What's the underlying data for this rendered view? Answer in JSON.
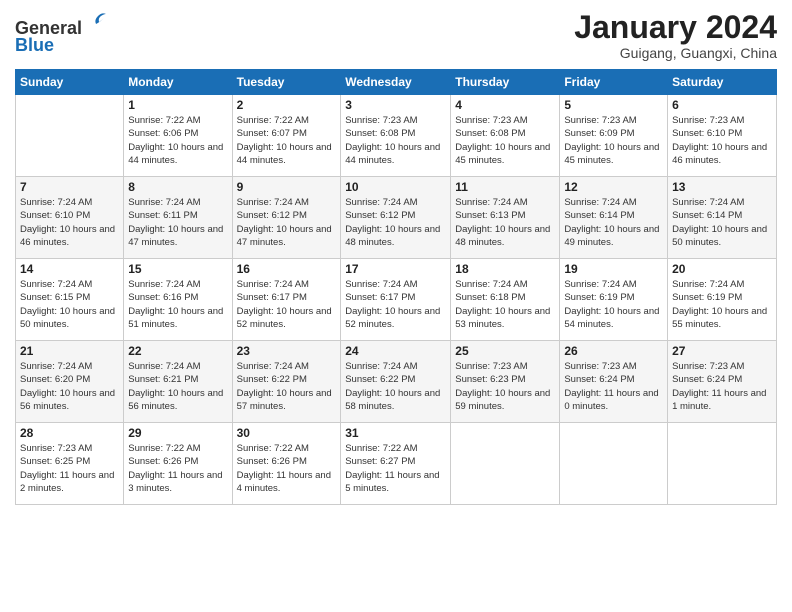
{
  "header": {
    "logo_line1": "General",
    "logo_line2": "Blue",
    "month_title": "January 2024",
    "location": "Guigang, Guangxi, China"
  },
  "days_of_week": [
    "Sunday",
    "Monday",
    "Tuesday",
    "Wednesday",
    "Thursday",
    "Friday",
    "Saturday"
  ],
  "weeks": [
    [
      {
        "day": "",
        "info": ""
      },
      {
        "day": "1",
        "info": "Sunrise: 7:22 AM\nSunset: 6:06 PM\nDaylight: 10 hours\nand 44 minutes."
      },
      {
        "day": "2",
        "info": "Sunrise: 7:22 AM\nSunset: 6:07 PM\nDaylight: 10 hours\nand 44 minutes."
      },
      {
        "day": "3",
        "info": "Sunrise: 7:23 AM\nSunset: 6:08 PM\nDaylight: 10 hours\nand 44 minutes."
      },
      {
        "day": "4",
        "info": "Sunrise: 7:23 AM\nSunset: 6:08 PM\nDaylight: 10 hours\nand 45 minutes."
      },
      {
        "day": "5",
        "info": "Sunrise: 7:23 AM\nSunset: 6:09 PM\nDaylight: 10 hours\nand 45 minutes."
      },
      {
        "day": "6",
        "info": "Sunrise: 7:23 AM\nSunset: 6:10 PM\nDaylight: 10 hours\nand 46 minutes."
      }
    ],
    [
      {
        "day": "7",
        "info": "Sunrise: 7:24 AM\nSunset: 6:10 PM\nDaylight: 10 hours\nand 46 minutes."
      },
      {
        "day": "8",
        "info": "Sunrise: 7:24 AM\nSunset: 6:11 PM\nDaylight: 10 hours\nand 47 minutes."
      },
      {
        "day": "9",
        "info": "Sunrise: 7:24 AM\nSunset: 6:12 PM\nDaylight: 10 hours\nand 47 minutes."
      },
      {
        "day": "10",
        "info": "Sunrise: 7:24 AM\nSunset: 6:12 PM\nDaylight: 10 hours\nand 48 minutes."
      },
      {
        "day": "11",
        "info": "Sunrise: 7:24 AM\nSunset: 6:13 PM\nDaylight: 10 hours\nand 48 minutes."
      },
      {
        "day": "12",
        "info": "Sunrise: 7:24 AM\nSunset: 6:14 PM\nDaylight: 10 hours\nand 49 minutes."
      },
      {
        "day": "13",
        "info": "Sunrise: 7:24 AM\nSunset: 6:14 PM\nDaylight: 10 hours\nand 50 minutes."
      }
    ],
    [
      {
        "day": "14",
        "info": "Sunrise: 7:24 AM\nSunset: 6:15 PM\nDaylight: 10 hours\nand 50 minutes."
      },
      {
        "day": "15",
        "info": "Sunrise: 7:24 AM\nSunset: 6:16 PM\nDaylight: 10 hours\nand 51 minutes."
      },
      {
        "day": "16",
        "info": "Sunrise: 7:24 AM\nSunset: 6:17 PM\nDaylight: 10 hours\nand 52 minutes."
      },
      {
        "day": "17",
        "info": "Sunrise: 7:24 AM\nSunset: 6:17 PM\nDaylight: 10 hours\nand 52 minutes."
      },
      {
        "day": "18",
        "info": "Sunrise: 7:24 AM\nSunset: 6:18 PM\nDaylight: 10 hours\nand 53 minutes."
      },
      {
        "day": "19",
        "info": "Sunrise: 7:24 AM\nSunset: 6:19 PM\nDaylight: 10 hours\nand 54 minutes."
      },
      {
        "day": "20",
        "info": "Sunrise: 7:24 AM\nSunset: 6:19 PM\nDaylight: 10 hours\nand 55 minutes."
      }
    ],
    [
      {
        "day": "21",
        "info": "Sunrise: 7:24 AM\nSunset: 6:20 PM\nDaylight: 10 hours\nand 56 minutes."
      },
      {
        "day": "22",
        "info": "Sunrise: 7:24 AM\nSunset: 6:21 PM\nDaylight: 10 hours\nand 56 minutes."
      },
      {
        "day": "23",
        "info": "Sunrise: 7:24 AM\nSunset: 6:22 PM\nDaylight: 10 hours\nand 57 minutes."
      },
      {
        "day": "24",
        "info": "Sunrise: 7:24 AM\nSunset: 6:22 PM\nDaylight: 10 hours\nand 58 minutes."
      },
      {
        "day": "25",
        "info": "Sunrise: 7:23 AM\nSunset: 6:23 PM\nDaylight: 10 hours\nand 59 minutes."
      },
      {
        "day": "26",
        "info": "Sunrise: 7:23 AM\nSunset: 6:24 PM\nDaylight: 11 hours\nand 0 minutes."
      },
      {
        "day": "27",
        "info": "Sunrise: 7:23 AM\nSunset: 6:24 PM\nDaylight: 11 hours\nand 1 minute."
      }
    ],
    [
      {
        "day": "28",
        "info": "Sunrise: 7:23 AM\nSunset: 6:25 PM\nDaylight: 11 hours\nand 2 minutes."
      },
      {
        "day": "29",
        "info": "Sunrise: 7:22 AM\nSunset: 6:26 PM\nDaylight: 11 hours\nand 3 minutes."
      },
      {
        "day": "30",
        "info": "Sunrise: 7:22 AM\nSunset: 6:26 PM\nDaylight: 11 hours\nand 4 minutes."
      },
      {
        "day": "31",
        "info": "Sunrise: 7:22 AM\nSunset: 6:27 PM\nDaylight: 11 hours\nand 5 minutes."
      },
      {
        "day": "",
        "info": ""
      },
      {
        "day": "",
        "info": ""
      },
      {
        "day": "",
        "info": ""
      }
    ]
  ]
}
